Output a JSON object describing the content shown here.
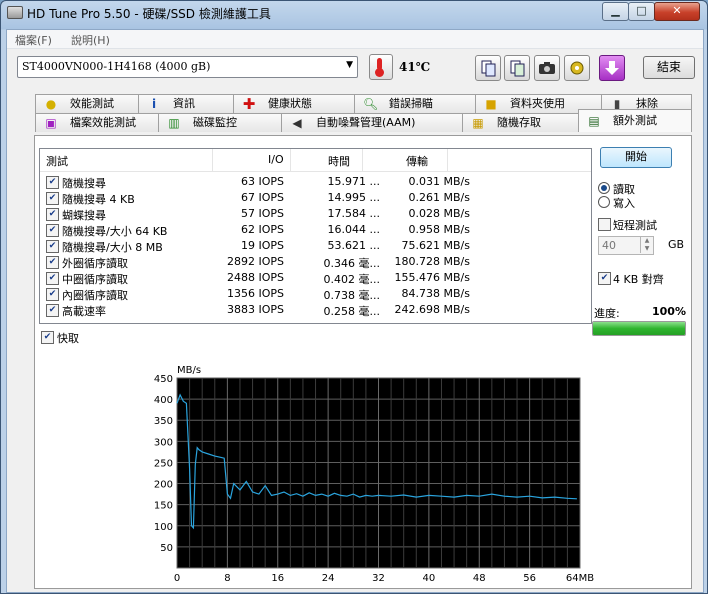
{
  "window": {
    "title": "HD Tune Pro 5.50 - 硬碟/SSD 檢測維護工具"
  },
  "menu": [
    "檔案(F)",
    "說明(H)"
  ],
  "toolbar": {
    "drive": "ST4000VN000-1H4168 (4000 gB)",
    "temperature": "41℃",
    "exit_label": "結束"
  },
  "tabs_row1": [
    {
      "label": "效能測試",
      "icon": "benchmark-icon"
    },
    {
      "label": "資訊",
      "icon": "info-icon"
    },
    {
      "label": "健康狀態",
      "icon": "health-icon"
    },
    {
      "label": "錯誤掃瞄",
      "icon": "error-scan-icon"
    },
    {
      "label": "資料夾使用",
      "icon": "folder-icon"
    },
    {
      "label": "抹除",
      "icon": "erase-icon"
    }
  ],
  "tabs_row2": [
    {
      "label": "檔案效能測試",
      "icon": "file-benchmark-icon"
    },
    {
      "label": "磁碟監控",
      "icon": "disk-monitor-icon"
    },
    {
      "label": "自動噪聲管理(AAM)",
      "icon": "aam-icon"
    },
    {
      "label": "隨機存取",
      "icon": "random-access-icon"
    },
    {
      "label": "額外測試",
      "icon": "extra-tests-icon",
      "active": true
    }
  ],
  "results": {
    "headers": {
      "test": "測試",
      "io": "I/O",
      "time": "時間",
      "transfer": "傳輸"
    },
    "rows": [
      {
        "name": "隨機搜尋",
        "io": "63 IOPS",
        "time": "15.971 ...",
        "transfer": "0.031 MB/s"
      },
      {
        "name": "隨機搜尋 4 KB",
        "io": "67 IOPS",
        "time": "14.995 ...",
        "transfer": "0.261 MB/s"
      },
      {
        "name": "蝴蝶搜尋",
        "io": "57 IOPS",
        "time": "17.584 ...",
        "transfer": "0.028 MB/s"
      },
      {
        "name": "隨機搜尋/大小 64 KB",
        "io": "62 IOPS",
        "time": "16.044 ...",
        "transfer": "0.958 MB/s"
      },
      {
        "name": "隨機搜尋/大小 8 MB",
        "io": "19 IOPS",
        "time": "53.621 ...",
        "transfer": "75.621 MB/s"
      },
      {
        "name": "外圈循序讀取",
        "io": "2892 IOPS",
        "time": "0.346 毫...",
        "transfer": "180.728 MB/s"
      },
      {
        "name": "中圈循序讀取",
        "io": "2488 IOPS",
        "time": "0.402 毫...",
        "transfer": "155.476 MB/s"
      },
      {
        "name": "內圈循序讀取",
        "io": "1356 IOPS",
        "time": "0.738 毫...",
        "transfer": "84.738 MB/s"
      },
      {
        "name": "高載速率",
        "io": "3883 IOPS",
        "time": "0.258 毫...",
        "transfer": "242.698 MB/s"
      }
    ]
  },
  "cache_label": "快取",
  "side": {
    "start_label": "開始",
    "read_label": "讀取",
    "write_label": "寫入",
    "short_test_label": "短程測試",
    "size_value": "40",
    "size_unit": "GB",
    "align_label": "4 KB 對齊",
    "progress_label": "進度:",
    "progress_text": "100%",
    "progress_value": 1.0
  },
  "chart_data": {
    "type": "line",
    "ylabel": "MB/s",
    "xlabel_suffix": "MB",
    "ylim": [
      0,
      450
    ],
    "xlim": [
      0,
      64
    ],
    "yticks": [
      50,
      100,
      150,
      200,
      250,
      300,
      350,
      400,
      450
    ],
    "xticks": [
      0,
      8,
      16,
      24,
      32,
      40,
      48,
      56,
      64
    ],
    "grid": true,
    "series": [
      {
        "color": "#2aa4de",
        "x": [
          0,
          0.5,
          1,
          1.5,
          2,
          2.3,
          2.6,
          2.9,
          3.2,
          3.5,
          4,
          5,
          6,
          7,
          7.5,
          8,
          8.5,
          9,
          10,
          11,
          12,
          13,
          14,
          15,
          16,
          17,
          18,
          19,
          20,
          21,
          22,
          23,
          24,
          25,
          26,
          27,
          28,
          29,
          30,
          31,
          32,
          34,
          36,
          38,
          40,
          42,
          44,
          46,
          48,
          50,
          52,
          54,
          56,
          58,
          60,
          62,
          63.5
        ],
        "y": [
          390,
          410,
          395,
          390,
          235,
          100,
          95,
          245,
          285,
          280,
          275,
          270,
          265,
          262,
          260,
          175,
          165,
          200,
          185,
          205,
          180,
          175,
          195,
          172,
          175,
          180,
          172,
          176,
          170,
          178,
          172,
          175,
          170,
          177,
          172,
          170,
          175,
          168,
          172,
          170,
          172,
          170,
          173,
          168,
          172,
          170,
          168,
          172,
          170,
          175,
          170,
          168,
          170,
          166,
          168,
          165,
          164
        ]
      }
    ]
  }
}
